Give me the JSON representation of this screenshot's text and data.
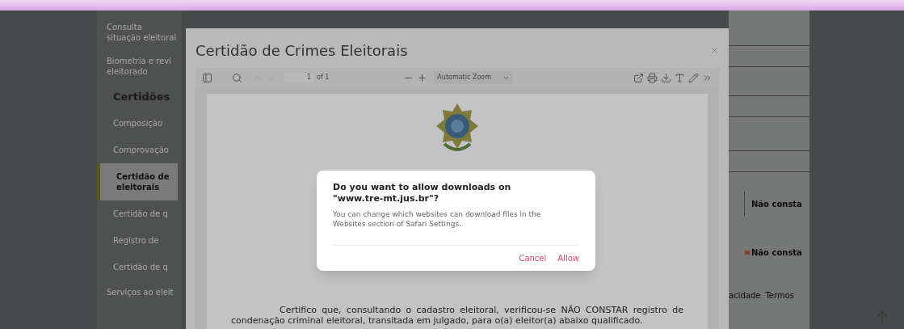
{
  "sidebar": {
    "items": [
      {
        "label": "Consulta situação eleitoral",
        "kind": "link",
        "selected": false
      },
      {
        "label": "Biometria e revi eleitorado",
        "kind": "link",
        "selected": false
      },
      {
        "label": "Certidões",
        "kind": "heading",
        "selected": false
      },
      {
        "label": "Composição",
        "kind": "sub",
        "selected": false
      },
      {
        "label": "Comprovação",
        "kind": "sub",
        "selected": false
      },
      {
        "label": "Certidão de eleitorais",
        "kind": "sub",
        "selected": true
      },
      {
        "label": "Certidão de q",
        "kind": "sub",
        "selected": false
      },
      {
        "label": "Registro de",
        "kind": "sub",
        "selected": false
      },
      {
        "label": "Certidão de q",
        "kind": "sub",
        "selected": false
      },
      {
        "label": "Serviços ao eleit",
        "kind": "link",
        "selected": false
      }
    ]
  },
  "modal": {
    "title": "Certidão de Crimes Eleitorais",
    "viewer": {
      "page": "1",
      "page_count": "of 1",
      "zoom": "Automatic Zoom",
      "paragraph": "Certifico que, consultando o cadastro eleitoral, verificou-se NÃO CONSTAR registro de condenação criminal eleitoral, transitada em julgado, para o(a) eleitor(a) abaixo qualificado."
    }
  },
  "alert": {
    "title": "Do you want to allow downloads on \"www.tre-mt.jus.br\"?",
    "message": "You can change which websites can download files in the Websites section of Safari Settings.",
    "buttons": [
      "Cancel",
      "Allow"
    ]
  },
  "right_panel": {
    "results": [
      "Não consta",
      "Não consta"
    ],
    "footer_links": [
      "acidade",
      "Termos"
    ]
  }
}
